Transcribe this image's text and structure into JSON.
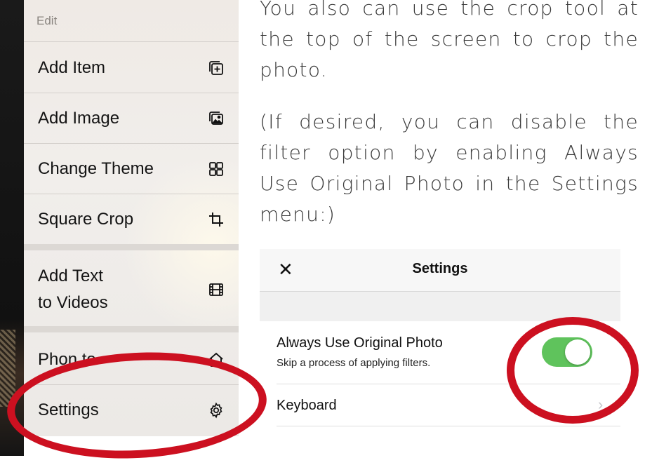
{
  "menu": {
    "header": "Edit",
    "items": [
      {
        "label": "Add Item",
        "icon": "add-item-icon"
      },
      {
        "label": "Add Image",
        "icon": "add-image-icon"
      },
      {
        "label": "Change Theme",
        "icon": "grid-icon"
      },
      {
        "label": "Square Crop",
        "icon": "crop-icon"
      },
      {
        "label_line1": "Add Text",
        "label_line2": "to Videos",
        "icon": "film-icon"
      },
      {
        "label": "Phon.to",
        "icon": "home-icon"
      },
      {
        "label": "Settings",
        "icon": "gear-icon"
      }
    ]
  },
  "article": {
    "p1": "You also can use the crop tool at the top of the screen to crop the photo.",
    "p2": "(If desired, you can disable the filter option by enabling Always Use Original Photo in the Settings menu:)"
  },
  "settings_screen": {
    "close_glyph": "✕",
    "title": "Settings",
    "row1_title": "Always Use Original Photo",
    "row1_subtitle": "Skip a process of applying filters.",
    "row1_toggle_on": true,
    "row2_title": "Keyboard",
    "chevron_glyph": "›"
  },
  "colors": {
    "highlight_ring": "#cc1020",
    "toggle_on": "#5fc35c"
  }
}
